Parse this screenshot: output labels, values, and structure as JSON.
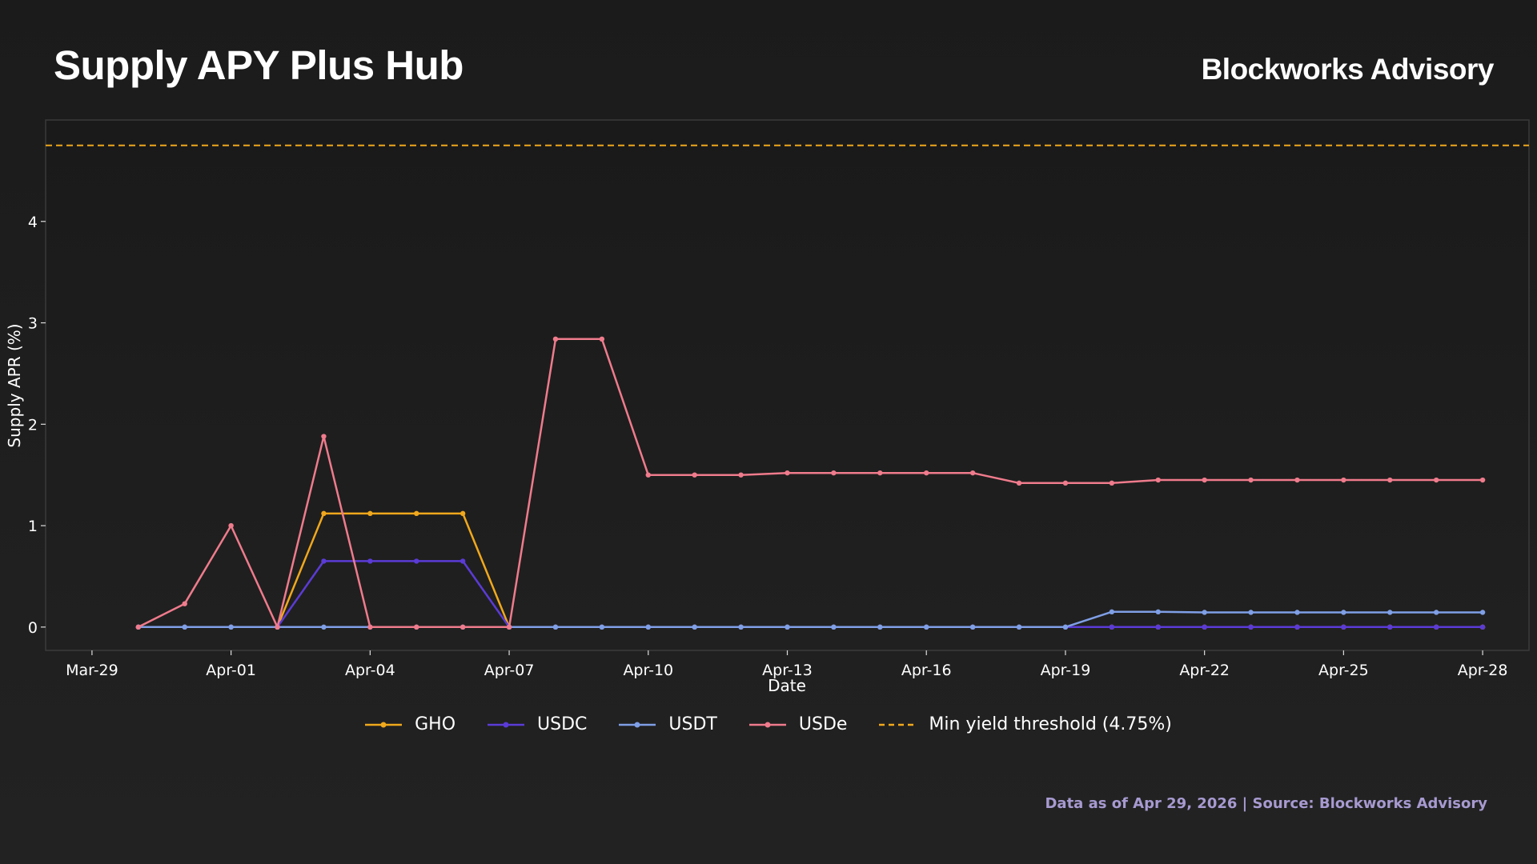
{
  "header": {
    "title": "Supply APY Plus Hub",
    "brand": "Blockworks Advisory"
  },
  "footer": {
    "source_note": "Data as of Apr 29, 2026 | Source: Blockworks Advisory"
  },
  "chart_data": {
    "type": "line",
    "title": "Supply APY Plus Hub",
    "xlabel": "Date",
    "ylabel": "Supply APR (%)",
    "x_ticks": [
      "Mar-29",
      "Apr-01",
      "Apr-04",
      "Apr-07",
      "Apr-10",
      "Apr-13",
      "Apr-16",
      "Apr-19",
      "Apr-22",
      "Apr-25",
      "Apr-28"
    ],
    "y_ticks": [
      "0",
      "1",
      "2",
      "3",
      "4"
    ],
    "ylim": [
      -0.23,
      5.0
    ],
    "xlim": [
      "Mar-28",
      "Apr-29"
    ],
    "grid": false,
    "legend_position": "bottom",
    "x": [
      "Mar-30",
      "Mar-31",
      "Apr-01",
      "Apr-02",
      "Apr-03",
      "Apr-04",
      "Apr-05",
      "Apr-06",
      "Apr-07",
      "Apr-08",
      "Apr-09",
      "Apr-10",
      "Apr-11",
      "Apr-12",
      "Apr-13",
      "Apr-14",
      "Apr-15",
      "Apr-16",
      "Apr-17",
      "Apr-18",
      "Apr-19",
      "Apr-20",
      "Apr-21",
      "Apr-22",
      "Apr-23",
      "Apr-24",
      "Apr-25",
      "Apr-26",
      "Apr-27",
      "Apr-28"
    ],
    "series": [
      {
        "name": "GHO",
        "color": "#f0a81c",
        "values": [
          0,
          0,
          0,
          0,
          1.12,
          1.12,
          1.12,
          1.12,
          0,
          0,
          0,
          0,
          0,
          0,
          0,
          0,
          0,
          0,
          0,
          0,
          0,
          0,
          0,
          0,
          0,
          0,
          0,
          0,
          0,
          0
        ]
      },
      {
        "name": "USDC",
        "color": "#5b3bd6",
        "values": [
          0,
          0,
          0,
          0,
          0.65,
          0.65,
          0.65,
          0.65,
          0,
          0,
          0,
          0,
          0,
          0,
          0,
          0,
          0,
          0,
          0,
          0,
          0,
          0,
          0,
          0,
          0,
          0,
          0,
          0,
          0,
          0
        ]
      },
      {
        "name": "USDT",
        "color": "#7f9fe6",
        "values": [
          0,
          0,
          0,
          0,
          0,
          0,
          0,
          0,
          0,
          0,
          0,
          0,
          0,
          0,
          0,
          0,
          0,
          0,
          0,
          0,
          0,
          0.15,
          0.15,
          0.145,
          0.145,
          0.145,
          0.145,
          0.145,
          0.145,
          0.145
        ]
      },
      {
        "name": "USDe",
        "color": "#ef7b8c",
        "values": [
          0,
          0.23,
          1.0,
          0,
          1.88,
          0,
          0,
          0,
          0,
          2.84,
          2.84,
          1.5,
          1.5,
          1.5,
          1.52,
          1.52,
          1.52,
          1.52,
          1.52,
          1.42,
          1.42,
          1.42,
          1.45,
          1.45,
          1.45,
          1.45,
          1.45,
          1.45,
          1.45,
          1.45
        ]
      }
    ],
    "threshold": {
      "name": "Min yield threshold (4.75%)",
      "value": 4.75,
      "color": "#f0a81c",
      "style": "dashed"
    }
  }
}
